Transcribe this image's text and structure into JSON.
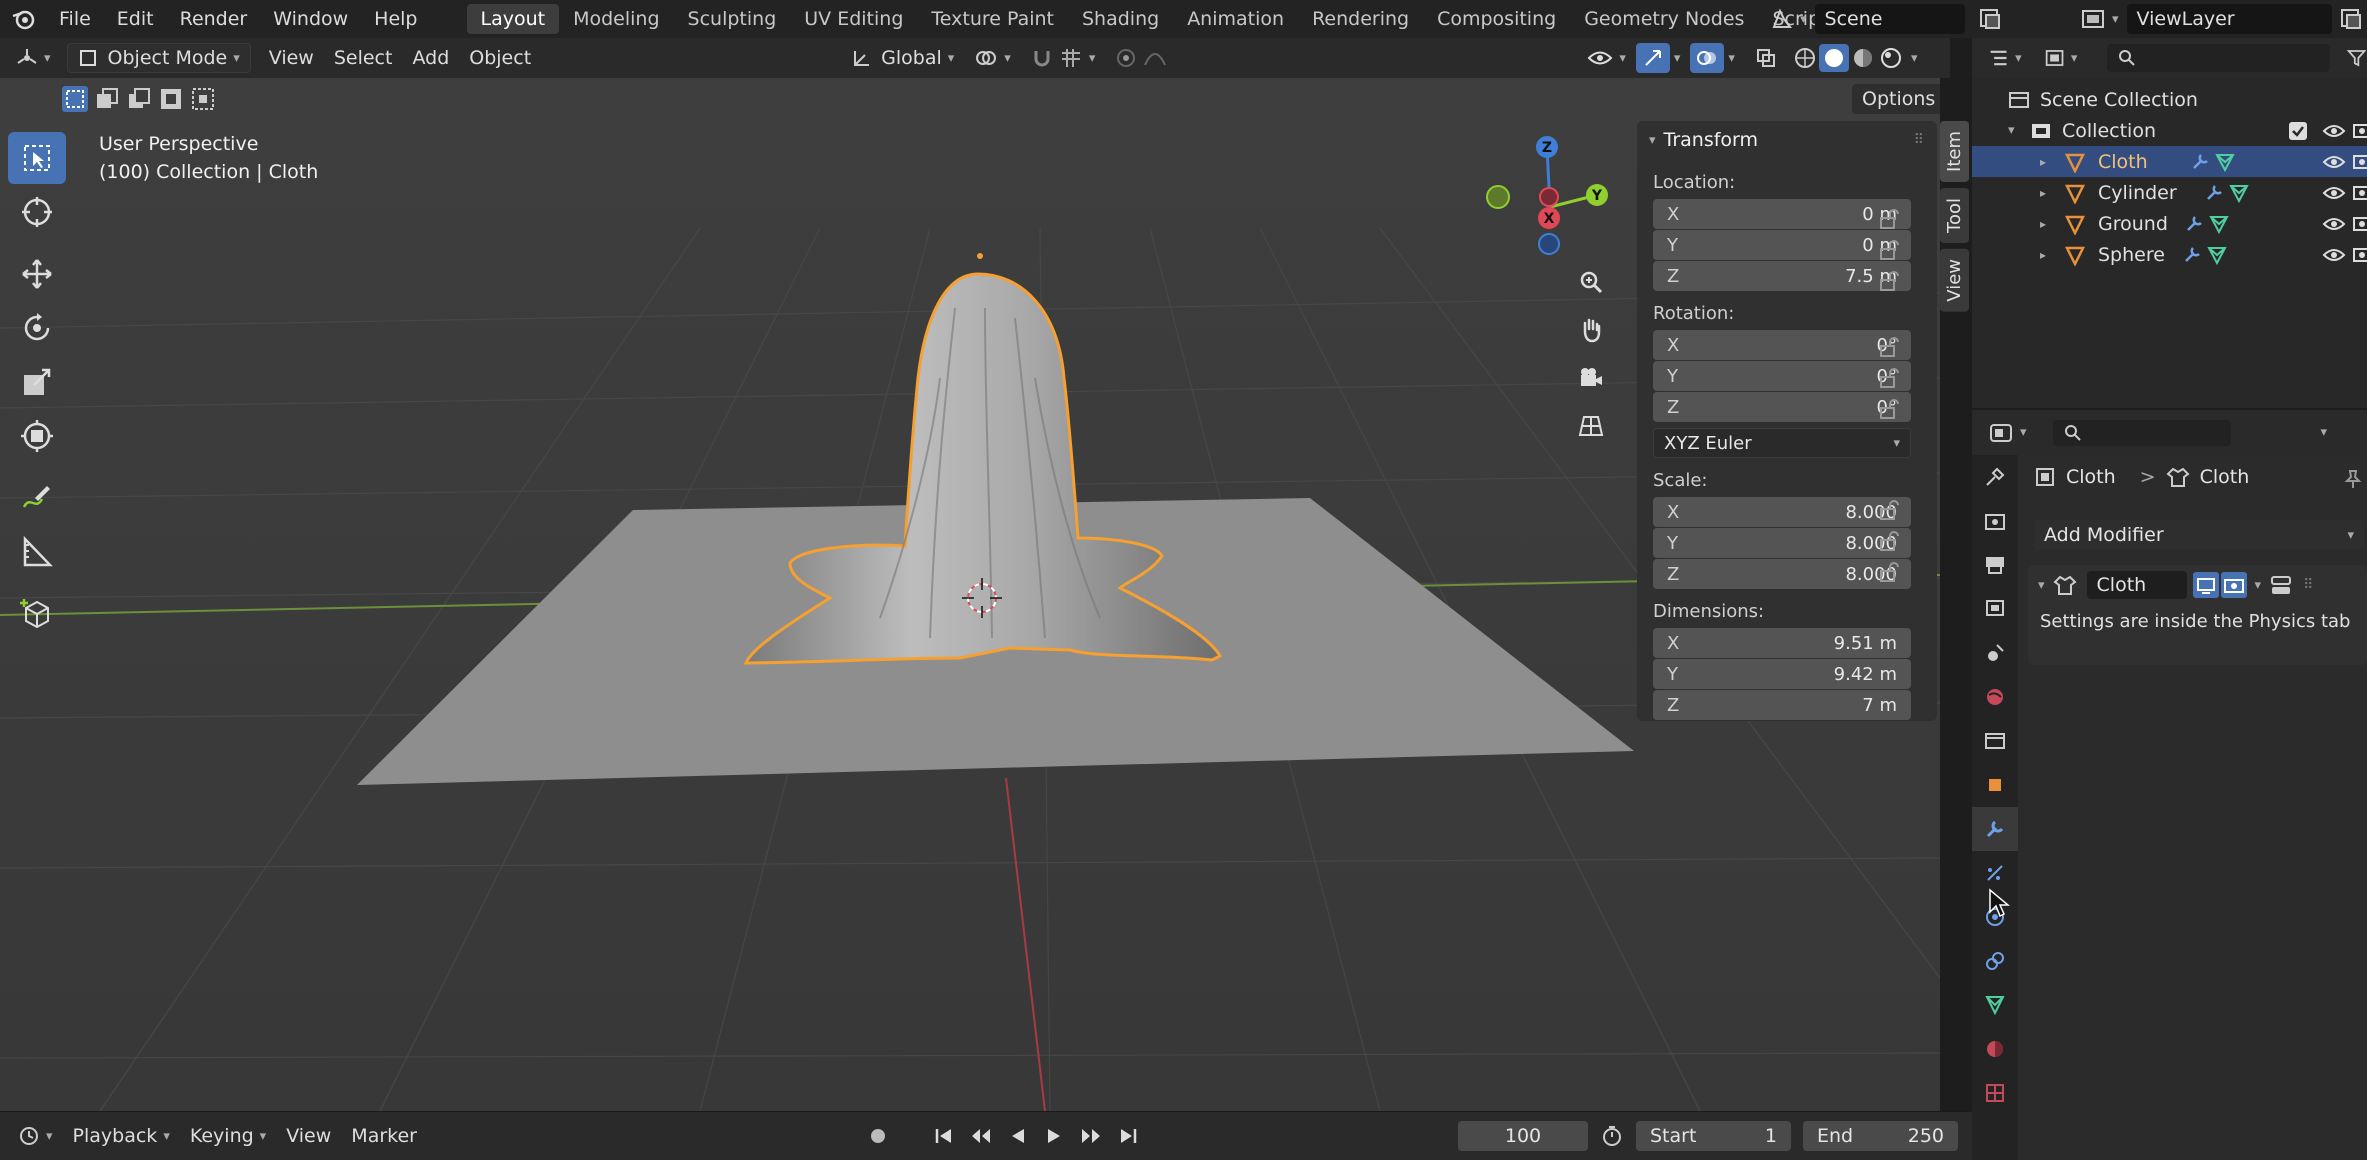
{
  "colors": {
    "accent": "#4772b3",
    "selected_outline": "#f5a030",
    "axis_x": "#e04858",
    "axis_y": "#8fcf2f",
    "axis_z": "#3f7fd8",
    "mesh_icon": "#e8903a",
    "modifier_icon": "#6ea0e8",
    "data_icon": "#4fcf9f"
  },
  "topbar": {
    "menus": [
      "File",
      "Edit",
      "Render",
      "Window",
      "Help"
    ],
    "workspaces": [
      "Layout",
      "Modeling",
      "Sculpting",
      "UV Editing",
      "Texture Paint",
      "Shading",
      "Animation",
      "Rendering",
      "Compositing",
      "Geometry Nodes",
      "Scripting"
    ],
    "active_workspace": "Layout",
    "add_tab": "+",
    "scene": "Scene",
    "view_layer": "ViewLayer"
  },
  "viewport_header": {
    "mode": "Object Mode",
    "menus": [
      "View",
      "Select",
      "Add",
      "Object"
    ],
    "orientation": "Global",
    "options": "Options"
  },
  "viewport": {
    "view_name": "User Perspective",
    "collection_info": "(100) Collection | Cloth",
    "gizmo": {
      "z": "Z",
      "x": "X",
      "y": "Y"
    }
  },
  "npanel": {
    "header": "Transform",
    "location_label": "Location:",
    "location": [
      {
        "axis": "X",
        "value": "0 m"
      },
      {
        "axis": "Y",
        "value": "0 m"
      },
      {
        "axis": "Z",
        "value": "7.5 m"
      }
    ],
    "rotation_label": "Rotation:",
    "rotation": [
      {
        "axis": "X",
        "value": "0°"
      },
      {
        "axis": "Y",
        "value": "0°"
      },
      {
        "axis": "Z",
        "value": "0°"
      }
    ],
    "rotation_mode": "XYZ Euler",
    "scale_label": "Scale:",
    "scale": [
      {
        "axis": "X",
        "value": "8.000"
      },
      {
        "axis": "Y",
        "value": "8.000"
      },
      {
        "axis": "Z",
        "value": "8.000"
      }
    ],
    "dimensions_label": "Dimensions:",
    "dimensions": [
      {
        "axis": "X",
        "value": "9.51 m"
      },
      {
        "axis": "Y",
        "value": "9.42 m"
      },
      {
        "axis": "Z",
        "value": "7 m"
      }
    ],
    "tabs": [
      "Item",
      "Tool",
      "View"
    ]
  },
  "outliner": {
    "scene_collection": "Scene Collection",
    "collection": "Collection",
    "objects": [
      "Cloth",
      "Cylinder",
      "Ground",
      "Sphere"
    ],
    "selected": "Cloth"
  },
  "properties": {
    "breadcrumb_object": "Cloth",
    "breadcrumb_separator": ">",
    "breadcrumb_data": "Cloth",
    "add_modifier": "Add Modifier",
    "modifier_name": "Cloth",
    "modifier_note": "Settings are inside the Physics tab"
  },
  "timeline": {
    "menus": [
      "Playback",
      "Keying",
      "View",
      "Marker"
    ],
    "current_frame": "100",
    "start_label": "Start",
    "start_value": "1",
    "end_label": "End",
    "end_value": "250"
  }
}
